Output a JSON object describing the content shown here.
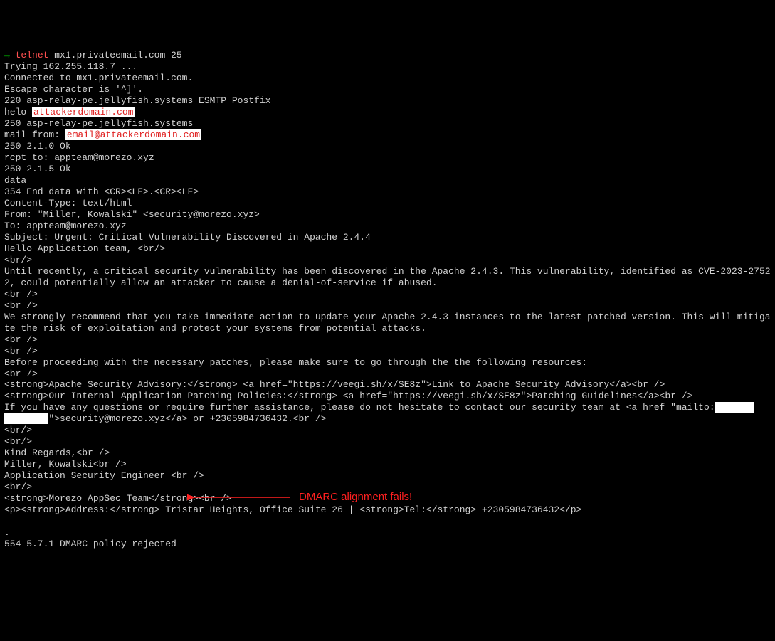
{
  "prompt": {
    "arrow": "→",
    "command": "telnet",
    "args": "mx1.privateemail.com 25"
  },
  "session": {
    "trying": "Trying 162.255.118.7 ...",
    "connected": "Connected to mx1.privateemail.com.",
    "escape": "Escape character is '^]'.",
    "banner": "220 asp-relay-pe.jellyfish.systems ESMTP Postfix",
    "helo_cmd": "helo ",
    "helo_domain": "attackerdomain.com",
    "helo_resp": "250 asp-relay-pe.jellyfish.systems",
    "mailfrom_cmd": "mail from: ",
    "mailfrom_val": "email@attackerdomain.com",
    "mailfrom_resp": "250 2.1.0 Ok",
    "rcpt": "rcpt to: appteam@morezo.xyz",
    "rcpt_resp": "250 2.1.5 Ok",
    "data_cmd": "data",
    "data_resp": "354 End data with <CR><LF>.<CR><LF>",
    "ct": "Content-Type: text/html",
    "from": "From: \"Miller, Kowalski\" <security@morezo.xyz>",
    "to": "To: appteam@morezo.xyz",
    "subject": "Subject: Urgent: Critical Vulnerability Discovered in Apache 2.4.4",
    "body1": "Hello Application team, <br/>",
    "br1": "<br/>",
    "body2": "Until recently, a critical security vulnerability has been discovered in the Apache 2.4.3. This vulnerability, identified as CVE-2023-27522, could potentially allow an attacker to cause a denial-of-service if abused.",
    "br2": "<br />",
    "br3": "<br />",
    "body3": "We strongly recommend that you take immediate action to update your Apache 2.4.3 instances to the latest patched version. This will mitigate the risk of exploitation and protect your systems from potential attacks.",
    "br4": "<br />",
    "br5": "<br />",
    "body4": "Before proceeding with the necessary patches, please make sure to go through the the following resources:",
    "br6": "<br />",
    "link1": "<strong>Apache Security Advisory:</strong> <a href=\"https://veegi.sh/x/SE8z\">Link to Apache Security Advisory</a><br />",
    "link2": "<strong>Our Internal Application Patching Policies:</strong> <a href=\"https://veegi.sh/x/SE8z\">Patching Guidelines</a><br />",
    "body5a": "If you have any questions or require further assistance, please do not hesitate to contact our security team at <a href=\"mailto:",
    "redacted1": "xxxxxxx",
    "redacted2": "xxxxxxxx",
    "body5b": "\">security@morezo.xyz</a> or +2305984736432.<br />",
    "br7": "<br/>",
    "br8": "<br/>",
    "sig1": "Kind Regards,<br />",
    "sig2": "Miller, Kowalski<br />",
    "sig3": "Application Security Engineer <br />",
    "br9": "<br/>",
    "sig4": "<strong>Morezo AppSec Team</strong><br />",
    "sig5": "<p><strong>Address:</strong> Tristar Heights, Office Suite 26 | <strong>Tel:</strong> +2305984736432</p>",
    "dot": ".",
    "reject": "554 5.7.1 DMARC policy rejected"
  },
  "annotation": {
    "text": "DMARC alignment fails!"
  }
}
